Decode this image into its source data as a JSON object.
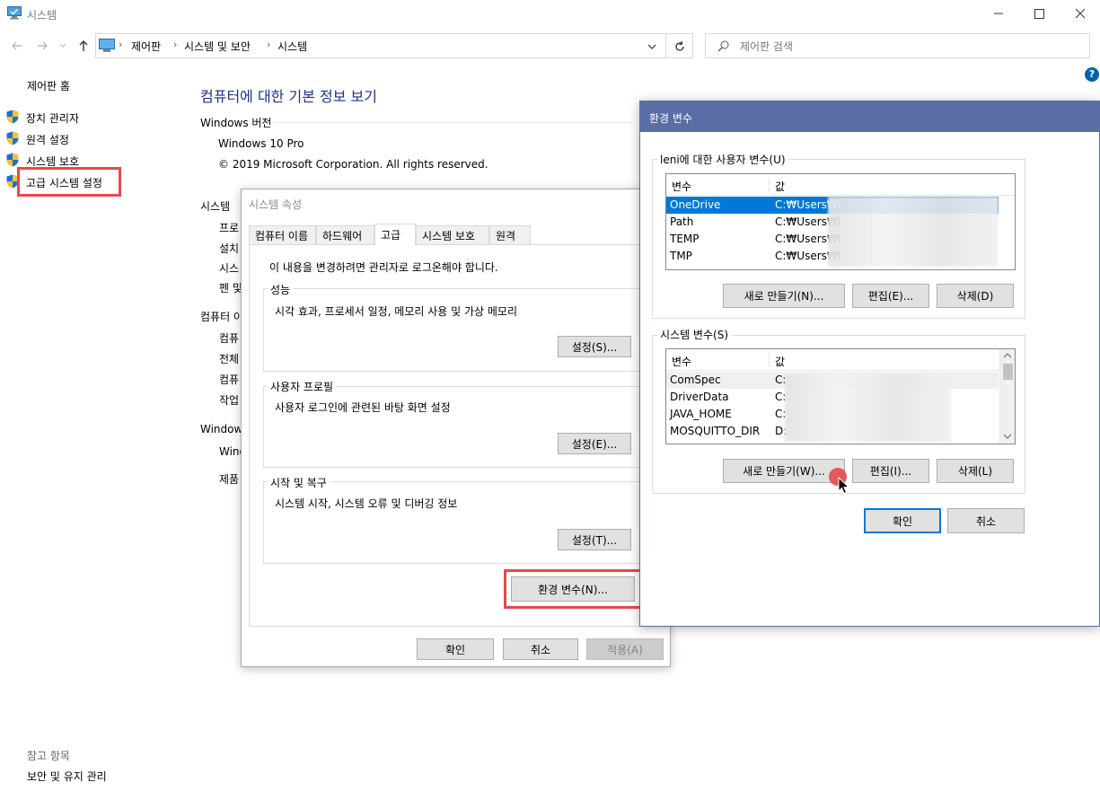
{
  "window": {
    "title": "시스템"
  },
  "address_bar": {
    "breadcrumb": [
      "제어판",
      "시스템 및 보안",
      "시스템"
    ],
    "search_placeholder": "제어판 검색"
  },
  "sidebar": {
    "home": "제어판 홈",
    "items": [
      "장치 관리자",
      "원격 설정",
      "시스템 보호",
      "고급 시스템 설정"
    ],
    "see_also_title": "참고 항목",
    "see_also_items": [
      "보안 및 유지 관리"
    ]
  },
  "main": {
    "title": "컴퓨터에 대한 기본 정보 보기",
    "windows_edition_header": "Windows 버전",
    "edition": "Windows 10 Pro",
    "copyright": "© 2019 Microsoft Corporation. All rights reserved.",
    "system_header": "시스템",
    "system_rows": [
      "프로",
      "설치",
      "시스",
      "펜 및"
    ],
    "computer_header": "컴퓨터 이",
    "computer_rows": [
      "컴퓨",
      "전체",
      "컴퓨",
      "작업"
    ],
    "activation_header": "Windows",
    "activation_rows": [
      "Wind",
      "제품"
    ]
  },
  "sys_props": {
    "title": "시스템 속성",
    "tabs": [
      "컴퓨터 이름",
      "하드웨어",
      "고급",
      "시스템 보호",
      "원격"
    ],
    "active_tab": "고급",
    "admin_note": "이 내용을 변경하려면 관리자로 로그온해야 합니다.",
    "performance": {
      "title": "성능",
      "desc": "시각 효과, 프로세서 일정, 메모리 사용 및 가상 메모리",
      "button": "설정(S)..."
    },
    "user_profiles": {
      "title": "사용자 프로필",
      "desc": "사용자 로그인에 관련된 바탕 화면 설정",
      "button": "설정(E)..."
    },
    "startup": {
      "title": "시작 및 복구",
      "desc": "시스템 시작, 시스템 오류 및 디버깅 정보",
      "button": "설정(T)..."
    },
    "env_button": "환경 변수(N)...",
    "ok": "확인",
    "cancel": "취소",
    "apply": "적용(A)"
  },
  "env_vars": {
    "title": "환경 변수",
    "user_group_title": "leni에 대한 사용자 변수(U)",
    "col_var": "변수",
    "col_val": "값",
    "user_vars": [
      {
        "name": "OneDrive",
        "value": "C:₩Users₩l"
      },
      {
        "name": "Path",
        "value": "C:₩Users₩l"
      },
      {
        "name": "TEMP",
        "value": "C:₩Users₩l"
      },
      {
        "name": "TMP",
        "value": "C:₩Users₩l"
      }
    ],
    "user_buttons": [
      "새로 만들기(N)...",
      "편집(E)...",
      "삭제(D)"
    ],
    "system_group_title": "시스템 변수(S)",
    "system_vars": [
      {
        "name": "ComSpec",
        "value": "C:"
      },
      {
        "name": "DriverData",
        "value": "C:"
      },
      {
        "name": "JAVA_HOME",
        "value": "C:"
      },
      {
        "name": "MOSQUITTO_DIR",
        "value": "D:"
      }
    ],
    "system_buttons": [
      "새로 만들기(W)...",
      "편집(I)...",
      "삭제(L)"
    ],
    "ok": "확인",
    "cancel": "취소"
  },
  "colors": {
    "accent": "#0078d7",
    "highlight_box": "#e8484b",
    "title_blue": "#1e3287",
    "env_titlebar": "#5a6ea5"
  }
}
